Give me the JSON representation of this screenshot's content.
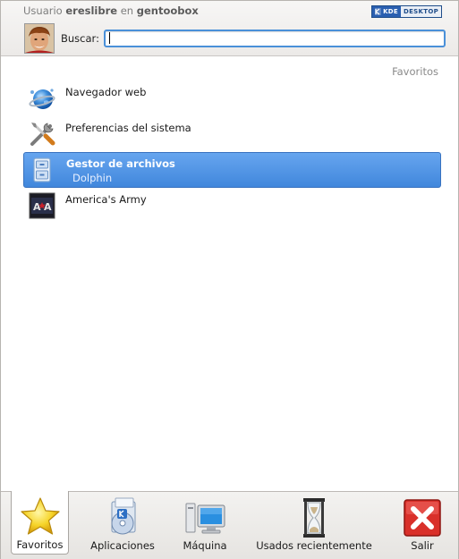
{
  "header": {
    "user_prefix": "Usuario",
    "username": "ereslibre",
    "host_prefix": "en",
    "hostname": "gentoobox",
    "badge_left": "KDE",
    "badge_right": "DESKTOP"
  },
  "search": {
    "label": "Buscar:",
    "value": "",
    "placeholder": ""
  },
  "favorites": {
    "section_title": "Favoritos",
    "items": [
      {
        "name": "Navegador web",
        "subtitle": "",
        "icon": "web-browser-globe-icon",
        "selected": false
      },
      {
        "name": "Preferencias del sistema",
        "subtitle": "",
        "icon": "system-settings-tools-icon",
        "selected": false
      },
      {
        "name": "Gestor de archivos",
        "subtitle": "Dolphin",
        "icon": "file-manager-cabinet-icon",
        "selected": true
      },
      {
        "name": "America's Army",
        "subtitle": "",
        "icon": "americas-army-game-icon",
        "selected": false
      }
    ]
  },
  "tabs": [
    {
      "label": "Favoritos",
      "icon": "star-icon",
      "active": true
    },
    {
      "label": "Aplicaciones",
      "icon": "applications-icon",
      "active": false
    },
    {
      "label": "Máquina",
      "icon": "computer-icon",
      "active": false
    },
    {
      "label": "Usados recientemente",
      "icon": "hourglass-icon",
      "active": false
    },
    {
      "label": "Salir",
      "icon": "exit-icon",
      "active": false
    }
  ],
  "colors": {
    "selection": "#4a8fe0",
    "search_border": "#4a90d9",
    "exit_red": "#d9302a"
  }
}
